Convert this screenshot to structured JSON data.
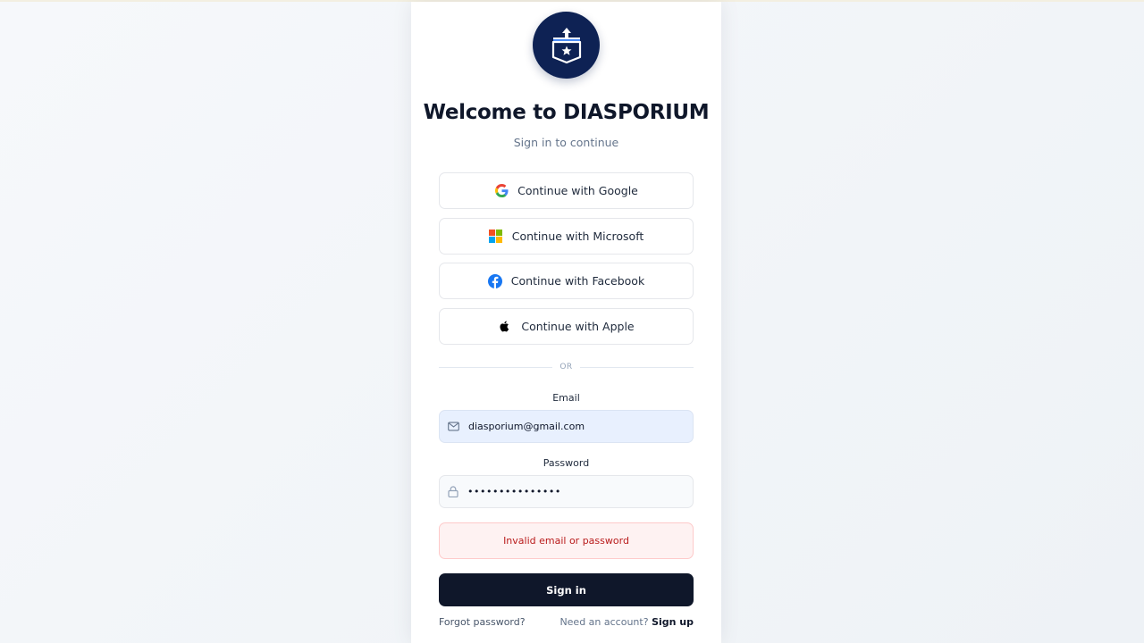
{
  "app": {
    "title": "Welcome to DIASPORIUM",
    "subtitle": "Sign in to continue"
  },
  "social": [
    {
      "label": "Continue with Google",
      "icon": "google-icon"
    },
    {
      "label": "Continue with Microsoft",
      "icon": "microsoft-icon"
    },
    {
      "label": "Continue with Facebook",
      "icon": "facebook-icon"
    },
    {
      "label": "Continue with Apple",
      "icon": "apple-icon"
    }
  ],
  "divider": "OR",
  "form": {
    "email_label": "Email",
    "email_value": "diasporium@gmail.com",
    "password_label": "Password",
    "password_value": "•••••••••••••••",
    "error": "Invalid email or password",
    "submit": "Sign in"
  },
  "footer": {
    "forgot": "Forgot password?",
    "need_account": "Need an account?",
    "signup": "Sign up"
  },
  "colors": {
    "brand": "#0e2254",
    "primary_button": "#0f172a",
    "error_text": "#b91c1c",
    "error_bg": "#fef2f2"
  }
}
